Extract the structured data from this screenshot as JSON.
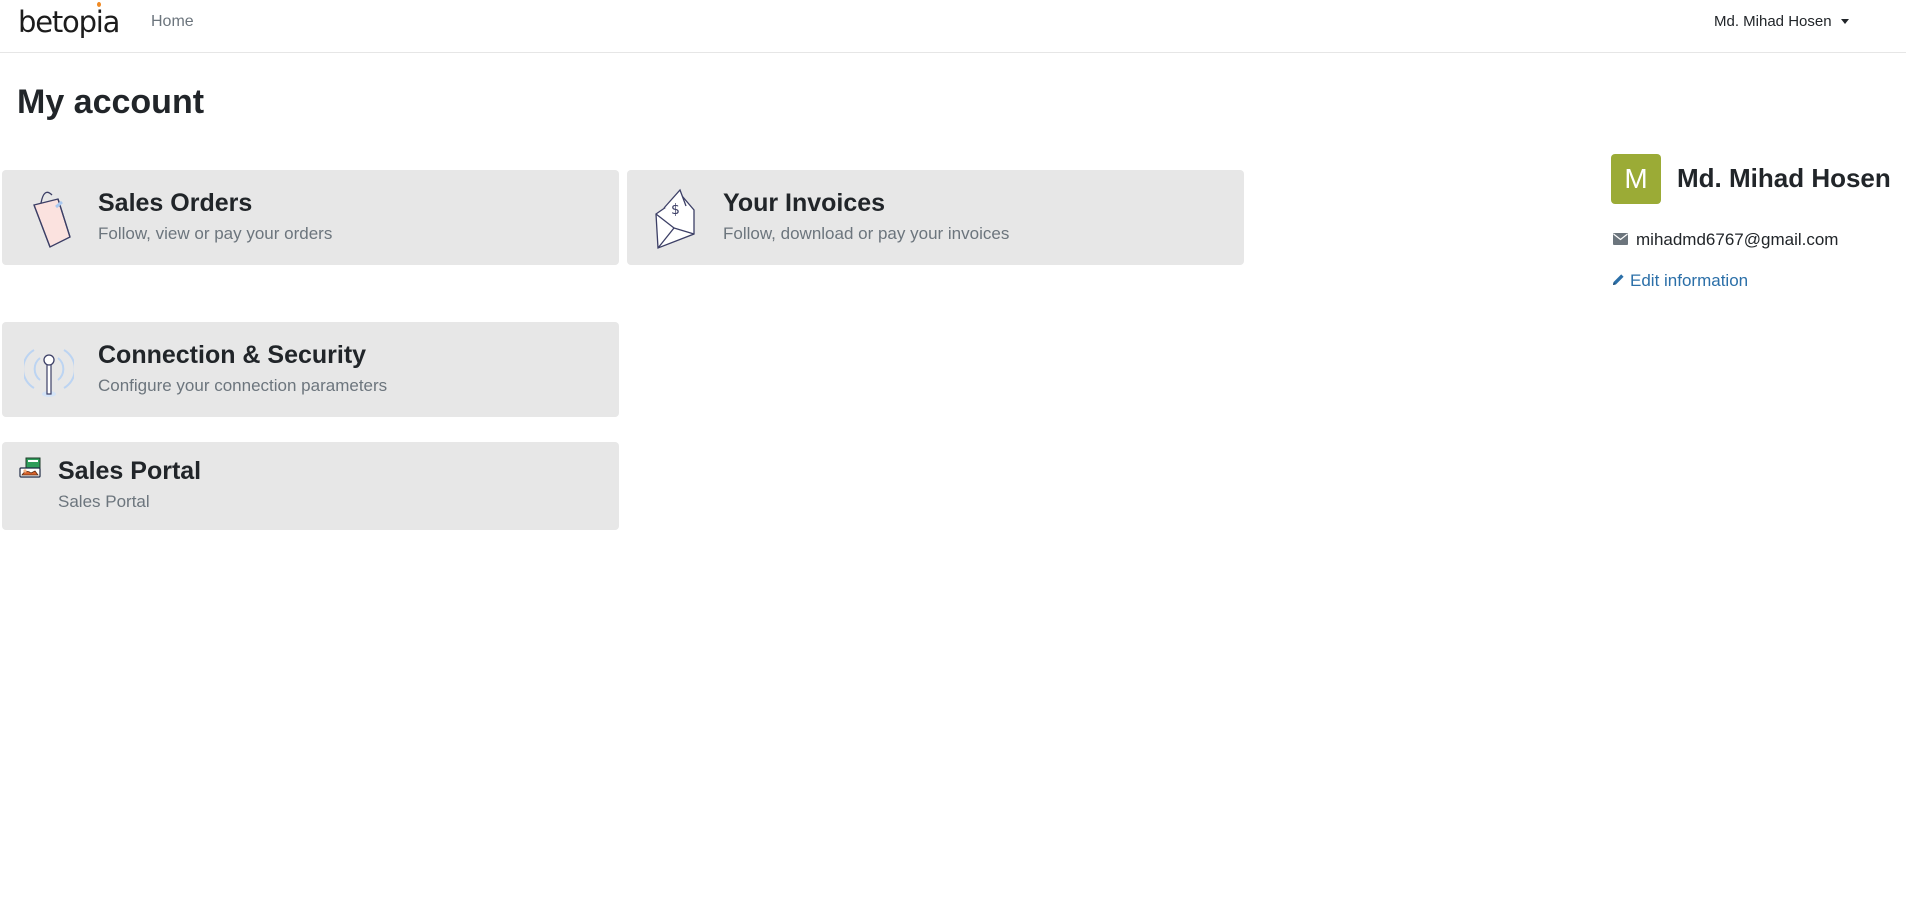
{
  "header": {
    "brand": "betopia",
    "nav_home": "Home",
    "user_menu": "Md. Mihad Hosen"
  },
  "page": {
    "title": "My account"
  },
  "cards": [
    {
      "title": "Sales Orders",
      "subtitle": "Follow, view or pay your orders",
      "icon": "shopping-bag-icon"
    },
    {
      "title": "Your Invoices",
      "subtitle": "Follow, download or pay your invoices",
      "icon": "invoice-envelope-icon"
    },
    {
      "title": "Connection & Security",
      "subtitle": "Configure your connection parameters",
      "icon": "antenna-icon"
    },
    {
      "title": "Sales Portal",
      "subtitle": "Sales Portal",
      "icon": "sales-portal-icon"
    }
  ],
  "aside": {
    "avatar_letter": "M",
    "name": "Md. Mihad Hosen",
    "email": "mihadmd6767@gmail.com",
    "edit_label": "Edit information",
    "avatar_color": "#9bab36",
    "link_color": "#2b6fa8"
  }
}
